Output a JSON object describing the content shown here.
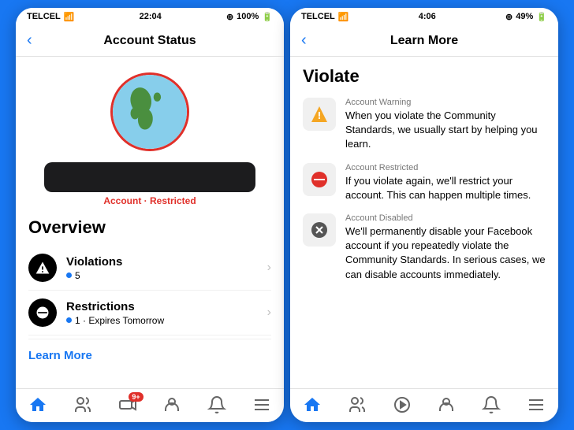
{
  "left_phone": {
    "carrier": "TELCEL",
    "time": "22:04",
    "battery": "100%",
    "nav_back": "‹",
    "nav_title": "Account Status",
    "account_label": "Account · ",
    "account_status": "Restricted",
    "overview_title": "Overview",
    "items": [
      {
        "title": "Violations",
        "subtitle": "5",
        "icon_type": "warning"
      },
      {
        "title": "Restrictions",
        "subtitle": "1 · Expires Tomorrow",
        "icon_type": "restrict"
      }
    ],
    "learn_more": "Learn More",
    "tab_icons": [
      "home",
      "friends",
      "video-badge",
      "profile",
      "bell",
      "menu"
    ]
  },
  "right_phone": {
    "carrier": "TELCEL",
    "time": "4:06",
    "battery": "49%",
    "nav_back": "‹",
    "nav_title": "Learn More",
    "violate_title": "Violate",
    "violation_items": [
      {
        "label": "Account Warning",
        "desc": "When you violate the Community Standards, we usually start by helping you learn.",
        "icon_type": "warning"
      },
      {
        "label": "Account Restricted",
        "desc": "If you violate again, we'll restrict your account. This can happen multiple times.",
        "icon_type": "restrict"
      },
      {
        "label": "Account Disabled",
        "desc": "We'll permanently disable your Facebook account if you repeatedly violate the Community Standards. In serious cases, we can disable accounts immediately.",
        "icon_type": "disabled"
      }
    ],
    "tab_icons": [
      "home",
      "friends",
      "play",
      "profile",
      "bell",
      "menu"
    ]
  }
}
